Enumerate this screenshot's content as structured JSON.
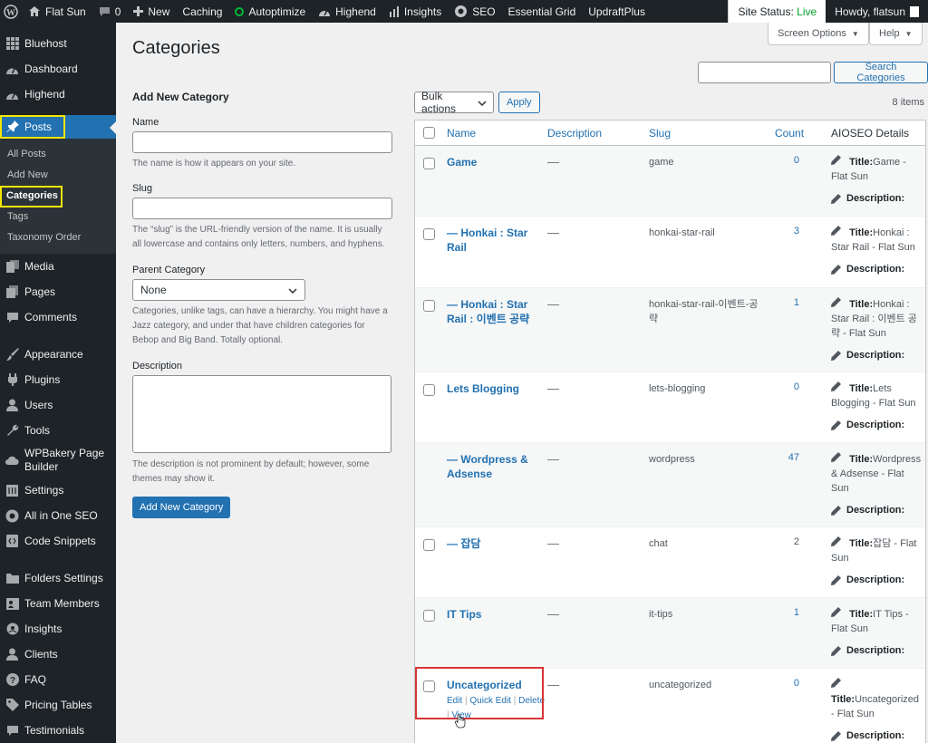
{
  "adminbar": {
    "items": [
      {
        "id": "site",
        "label": "Flat Sun",
        "icon": "home-icon"
      },
      {
        "id": "comments",
        "label": "0",
        "icon": "comment-icon"
      },
      {
        "id": "new",
        "label": "New",
        "icon": "plus-icon"
      },
      {
        "id": "caching",
        "label": "Caching",
        "icon": ""
      },
      {
        "id": "autoptimize",
        "label": "Autoptimize",
        "icon": "status-dot-icon"
      },
      {
        "id": "highend",
        "label": "Highend",
        "icon": "dashboard-icon"
      },
      {
        "id": "insights",
        "label": "Insights",
        "icon": "bar-chart-icon"
      },
      {
        "id": "seo",
        "label": "SEO",
        "icon": "gear-icon"
      },
      {
        "id": "essential",
        "label": "Essential Grid",
        "icon": ""
      },
      {
        "id": "updraft",
        "label": "UpdraftPlus",
        "icon": ""
      }
    ],
    "site_status_label": "Site Status:",
    "site_status_value": "Live",
    "howdy": "Howdy, flatsun"
  },
  "menu": {
    "items": [
      {
        "label": "Bluehost",
        "icon": "grid-icon"
      },
      {
        "label": "Dashboard",
        "icon": "dashboard-icon"
      },
      {
        "label": "Highend",
        "icon": "dashboard-icon"
      },
      {
        "label": "Posts",
        "icon": "pin-icon",
        "current": true
      },
      {
        "label": "Media",
        "icon": "media-icon"
      },
      {
        "label": "Pages",
        "icon": "pages-icon"
      },
      {
        "label": "Comments",
        "icon": "comment-icon"
      },
      {
        "label": "Appearance",
        "icon": "brush-icon"
      },
      {
        "label": "Plugins",
        "icon": "plugin-icon"
      },
      {
        "label": "Users",
        "icon": "user-icon"
      },
      {
        "label": "Tools",
        "icon": "wrench-icon"
      },
      {
        "label": "WPBakery Page Builder",
        "icon": "cloud-icon"
      },
      {
        "label": "Settings",
        "icon": "settings-icon"
      },
      {
        "label": "All in One SEO",
        "icon": "seo-icon"
      },
      {
        "label": "Code Snippets",
        "icon": "code-icon"
      },
      {
        "label": "Folders Settings",
        "icon": "folder-icon"
      },
      {
        "label": "Team Members",
        "icon": "team-icon"
      },
      {
        "label": "Insights",
        "icon": "insights-icon"
      },
      {
        "label": "Clients",
        "icon": "clients-icon"
      },
      {
        "label": "FAQ",
        "icon": "help-icon"
      },
      {
        "label": "Pricing Tables",
        "icon": "tag-icon"
      },
      {
        "label": "Testimonials",
        "icon": "quote-icon"
      }
    ],
    "posts_sub": [
      {
        "label": "All Posts"
      },
      {
        "label": "Add New"
      },
      {
        "label": "Categories",
        "current": true
      },
      {
        "label": "Tags"
      },
      {
        "label": "Taxonomy Order"
      }
    ]
  },
  "page": {
    "title": "Categories",
    "screen_options": "Screen Options",
    "help": "Help"
  },
  "form": {
    "heading": "Add New Category",
    "name_label": "Name",
    "name_help": "The name is how it appears on your site.",
    "slug_label": "Slug",
    "slug_help": "The “slug” is the URL-friendly version of the name. It is usually all lowercase and contains only letters, numbers, and hyphens.",
    "parent_label": "Parent Category",
    "parent_value": "None",
    "parent_help": "Categories, unlike tags, can have a hierarchy. You might have a Jazz category, and under that have children categories for Bebop and Big Band. Totally optional.",
    "desc_label": "Description",
    "desc_help": "The description is not prominent by default; however, some themes may show it.",
    "submit": "Add New Category"
  },
  "search": {
    "button": "Search Categories"
  },
  "tablenav": {
    "bulk": "Bulk actions",
    "apply": "Apply",
    "count": "8 items"
  },
  "table": {
    "columns": {
      "name": "Name",
      "description": "Description",
      "slug": "Slug",
      "count": "Count",
      "aioseo": "AIOSEO Details"
    },
    "title_prefix": "Title:",
    "desc_prefix": "Description:",
    "rows": [
      {
        "name": "Game",
        "desc": "—",
        "slug": "game",
        "count": "0",
        "title": "Game - Flat Sun"
      },
      {
        "name": "— Honkai : Star Rail",
        "desc": "—",
        "slug": "honkai-star-rail",
        "count": "3",
        "title": "Honkai : Star Rail - Flat Sun"
      },
      {
        "name": "— Honkai : Star Rail : 이벤트 공략",
        "desc": "—",
        "slug": "honkai-star-rail-이벤트-공략",
        "count": "1",
        "title": "Honkai : Star Rail : 이벤트 공략 - Flat Sun"
      },
      {
        "name": "Lets Blogging",
        "desc": "—",
        "slug": "lets-blogging",
        "count": "0",
        "title": "Lets Blogging - Flat Sun"
      },
      {
        "name": "— Wordpress & Adsense",
        "desc": "—",
        "slug": "wordpress",
        "count": "47",
        "title": "Wordpress & Adsense - Flat Sun"
      },
      {
        "name": "— 잡담",
        "desc": "—",
        "slug": "chat",
        "count": "2",
        "title": "잡담 - Flat Sun"
      },
      {
        "name": "IT Tips",
        "desc": "—",
        "slug": "it-tips",
        "count": "1",
        "title": "IT Tips - Flat Sun"
      },
      {
        "name": "Uncategorized",
        "desc": "—",
        "slug": "uncategorized",
        "count": "0",
        "title": "Uncategorized - Flat Sun",
        "actions": [
          "Edit",
          "Quick Edit",
          "Delete",
          "View"
        ]
      }
    ]
  }
}
